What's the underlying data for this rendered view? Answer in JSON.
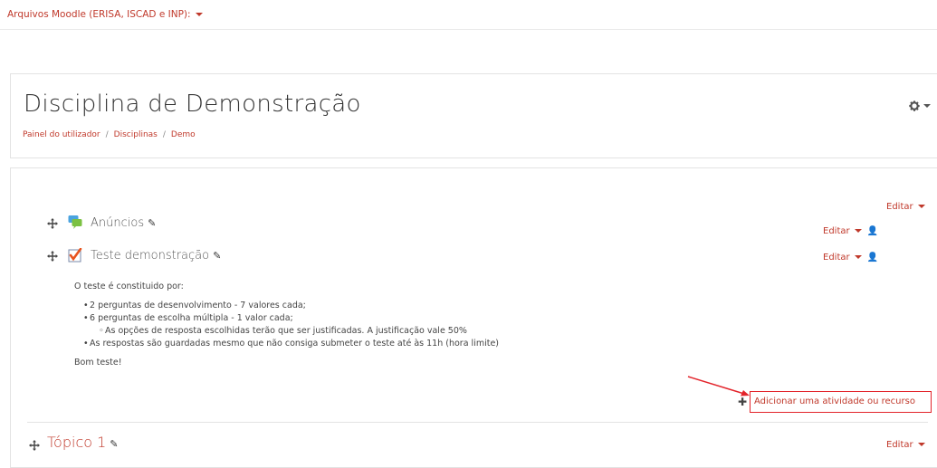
{
  "topnav": {
    "site_name": "Arquivos Moodle (ERISA, ISCAD e INP):"
  },
  "header": {
    "title": "Disciplina de Demonstração",
    "breadcrumb": [
      "Painel do utilizador",
      "Disciplinas",
      "Demo"
    ],
    "breadcrumb_separator": "/"
  },
  "section0": {
    "edit_label": "Editar",
    "activities": [
      {
        "name": "Anúncios",
        "icon": "forum-icon",
        "edit_label": "Editar"
      },
      {
        "name": "Teste demonstração",
        "icon": "quiz-icon",
        "edit_label": "Editar"
      }
    ],
    "description": {
      "intro": "O teste é constituido por:",
      "items": [
        "2 perguntas de desenvolvimento  - 7 valores cada;",
        "6 perguntas de escolha múltipla - 1 valor cada;"
      ],
      "subitems": [
        "As opções de resposta escolhidas terão que ser justificadas. A justificação vale 50%"
      ],
      "last_item": "As respostas são guardadas mesmo que não consiga submeter o teste até às 11h (hora limite)",
      "closing": "Bom teste!"
    },
    "add_activity": "Adicionar uma atividade ou recurso"
  },
  "topic1": {
    "title": "Tópico 1",
    "edit_label": "Editar"
  },
  "colors": {
    "accent": "#c0392b",
    "highlight_box": "#e3242b"
  }
}
